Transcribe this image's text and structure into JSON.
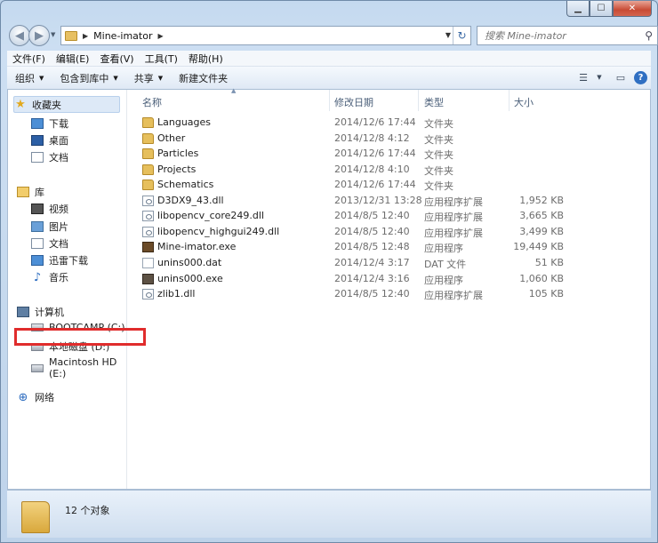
{
  "window": {
    "controls": [
      "minimize",
      "maximize",
      "close"
    ]
  },
  "address": {
    "crumb": "Mine-imator",
    "search_placeholder": "搜索 Mine-imator"
  },
  "menu": [
    "文件(F)",
    "编辑(E)",
    "查看(V)",
    "工具(T)",
    "帮助(H)"
  ],
  "toolbar": {
    "organize": "组织",
    "include_library": "包含到库中",
    "share": "共享",
    "new_folder": "新建文件夹"
  },
  "nav": {
    "favorites": "收藏夹",
    "favorites_items": [
      "下载",
      "桌面",
      "文档"
    ],
    "libraries": "库",
    "libraries_items": [
      "视频",
      "图片",
      "文档",
      "迅雷下载",
      "音乐"
    ],
    "computer": "计算机",
    "computer_items": [
      "BOOTCAMP (C:)",
      "本地磁盘 (D:)",
      "Macintosh HD (E:)"
    ],
    "network": "网络"
  },
  "columns": {
    "name": "名称",
    "modified": "修改日期",
    "type": "类型",
    "size": "大小"
  },
  "files": [
    {
      "name": "Languages",
      "modified": "2014/12/6 17:44",
      "type": "文件夹",
      "size": "",
      "icon": "folder"
    },
    {
      "name": "Other",
      "modified": "2014/12/8 4:12",
      "type": "文件夹",
      "size": "",
      "icon": "folder"
    },
    {
      "name": "Particles",
      "modified": "2014/12/6 17:44",
      "type": "文件夹",
      "size": "",
      "icon": "folder"
    },
    {
      "name": "Projects",
      "modified": "2014/12/8 4:10",
      "type": "文件夹",
      "size": "",
      "icon": "folder"
    },
    {
      "name": "Schematics",
      "modified": "2014/12/6 17:44",
      "type": "文件夹",
      "size": "",
      "icon": "folder"
    },
    {
      "name": "D3DX9_43.dll",
      "modified": "2013/12/31 13:28",
      "type": "应用程序扩展",
      "size": "1,952 KB",
      "icon": "dll"
    },
    {
      "name": "libopencv_core249.dll",
      "modified": "2014/8/5 12:40",
      "type": "应用程序扩展",
      "size": "3,665 KB",
      "icon": "dll"
    },
    {
      "name": "libopencv_highgui249.dll",
      "modified": "2014/8/5 12:40",
      "type": "应用程序扩展",
      "size": "3,499 KB",
      "icon": "dll"
    },
    {
      "name": "Mine-imator.exe",
      "modified": "2014/8/5 12:48",
      "type": "应用程序",
      "size": "19,449 KB",
      "icon": "exe"
    },
    {
      "name": "unins000.dat",
      "modified": "2014/12/4 3:17",
      "type": "DAT 文件",
      "size": "51 KB",
      "icon": "dat"
    },
    {
      "name": "unins000.exe",
      "modified": "2014/12/4 3:16",
      "type": "应用程序",
      "size": "1,060 KB",
      "icon": "exe2"
    },
    {
      "name": "zlib1.dll",
      "modified": "2014/8/5 12:40",
      "type": "应用程序扩展",
      "size": "105 KB",
      "icon": "dll"
    }
  ],
  "highlight_color": "#e02c2c",
  "status": {
    "count": "12 个对象"
  }
}
